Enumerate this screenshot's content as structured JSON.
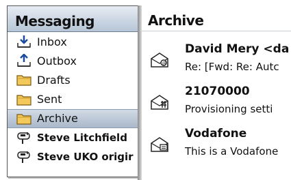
{
  "folders_pane": {
    "title": "Messaging",
    "items": [
      {
        "label": "Inbox",
        "icon": "inbox-icon"
      },
      {
        "label": "Outbox",
        "icon": "outbox-icon"
      },
      {
        "label": "Drafts",
        "icon": "folder-icon"
      },
      {
        "label": "Sent",
        "icon": "folder-icon"
      },
      {
        "label": "Archive",
        "icon": "folder-icon",
        "selected": true
      },
      {
        "label": "Steve Litchfield",
        "icon": "mailbox-icon"
      },
      {
        "label": "Steve UKO origir",
        "icon": "mailbox-icon"
      }
    ]
  },
  "messages_pane": {
    "title": "Archive",
    "messages": [
      {
        "sender": "David Mery <da",
        "subject": "Re: [Fwd: Re: Autc",
        "icon": "email-envelope-icon"
      },
      {
        "sender": "21070000",
        "subject": "Provisioning setti",
        "icon": "provisioning-envelope-icon"
      },
      {
        "sender": "Vodafone",
        "subject": "This is a Vodafone",
        "icon": "message-envelope-icon"
      }
    ]
  },
  "colors": {
    "header_gradient_top": "#e7ecf3",
    "header_gradient_bottom": "#b6c5d6",
    "folder_yellow": "#f2c95a"
  }
}
